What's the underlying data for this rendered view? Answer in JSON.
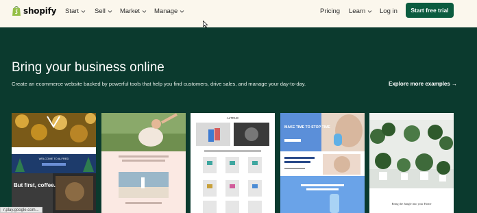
{
  "header": {
    "logo_text": "shopify",
    "nav": [
      "Start",
      "Sell",
      "Market",
      "Manage"
    ],
    "right_links": [
      "Pricing",
      "Learn",
      "Log in"
    ],
    "cta_label": "Start free trial"
  },
  "hero": {
    "title": "Bring your business online",
    "subtitle": "Create an ecommerce website backed by powerful tools that help you find customers, drive sales, and manage your day-to-day.",
    "explore_label": "Explore more examples →"
  },
  "thumbnails": {
    "t1": {
      "banner": "WELCOME TO ALFRED",
      "sign": "But first, coffee."
    },
    "t3": {
      "brand": "ALTRUE"
    },
    "t4": {
      "headline": "MAKE TIME TO STOP TIME"
    },
    "t5": {
      "caption": "Bring the Jungle into your Home"
    }
  },
  "status_bar": {
    "text": "r.play.google.com..."
  },
  "colors": {
    "header_bg": "#fbf7ed",
    "hero_bg": "#0b3a2e",
    "cta_bg": "#0b5c3f",
    "logo_green": "#95bf47"
  }
}
